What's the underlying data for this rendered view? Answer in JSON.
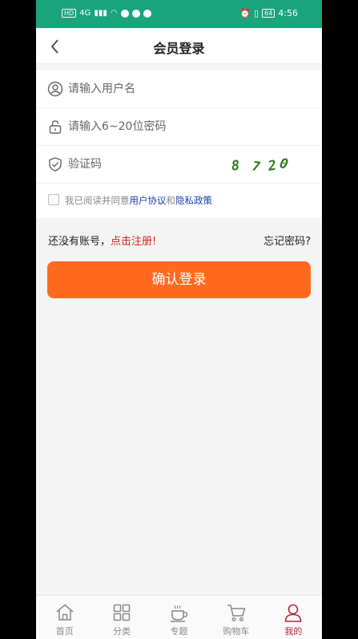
{
  "status_bar": {
    "left_icons": [
      "hd-icon",
      "signal-icon",
      "wifi-icon",
      "location-icon",
      "app-icon",
      "app-icon-2"
    ],
    "signal_text": "4G",
    "battery": "64",
    "time": "4:56"
  },
  "header": {
    "title": "会员登录"
  },
  "form": {
    "username_placeholder": "请输入用户名",
    "password_placeholder": "请输入6~20位密码",
    "captcha_placeholder": "验证码",
    "captcha_text": "8720"
  },
  "agreement": {
    "prefix": "我已阅读并同意",
    "user_agreement": "用户协议",
    "and": "和",
    "privacy_policy": "隐私政策"
  },
  "links": {
    "no_account": "还没有账号，",
    "register": "点击注册!",
    "forgot": "忘记密码?"
  },
  "login_button": "确认登录",
  "tabbar": {
    "items": [
      {
        "label": "首页",
        "icon": "home-icon"
      },
      {
        "label": "分类",
        "icon": "category-icon"
      },
      {
        "label": "专题",
        "icon": "coffee-icon"
      },
      {
        "label": "购物车",
        "icon": "cart-icon"
      },
      {
        "label": "我的",
        "icon": "user-icon"
      }
    ],
    "active_index": 4
  },
  "colors": {
    "status_bar": "#1aa47c",
    "primary_button": "#ff6a1f",
    "register_link": "#d41f1f",
    "agreement_link": "#1a3fa8",
    "active_tab": "#b0283a",
    "captcha": "#2f7a1a"
  }
}
